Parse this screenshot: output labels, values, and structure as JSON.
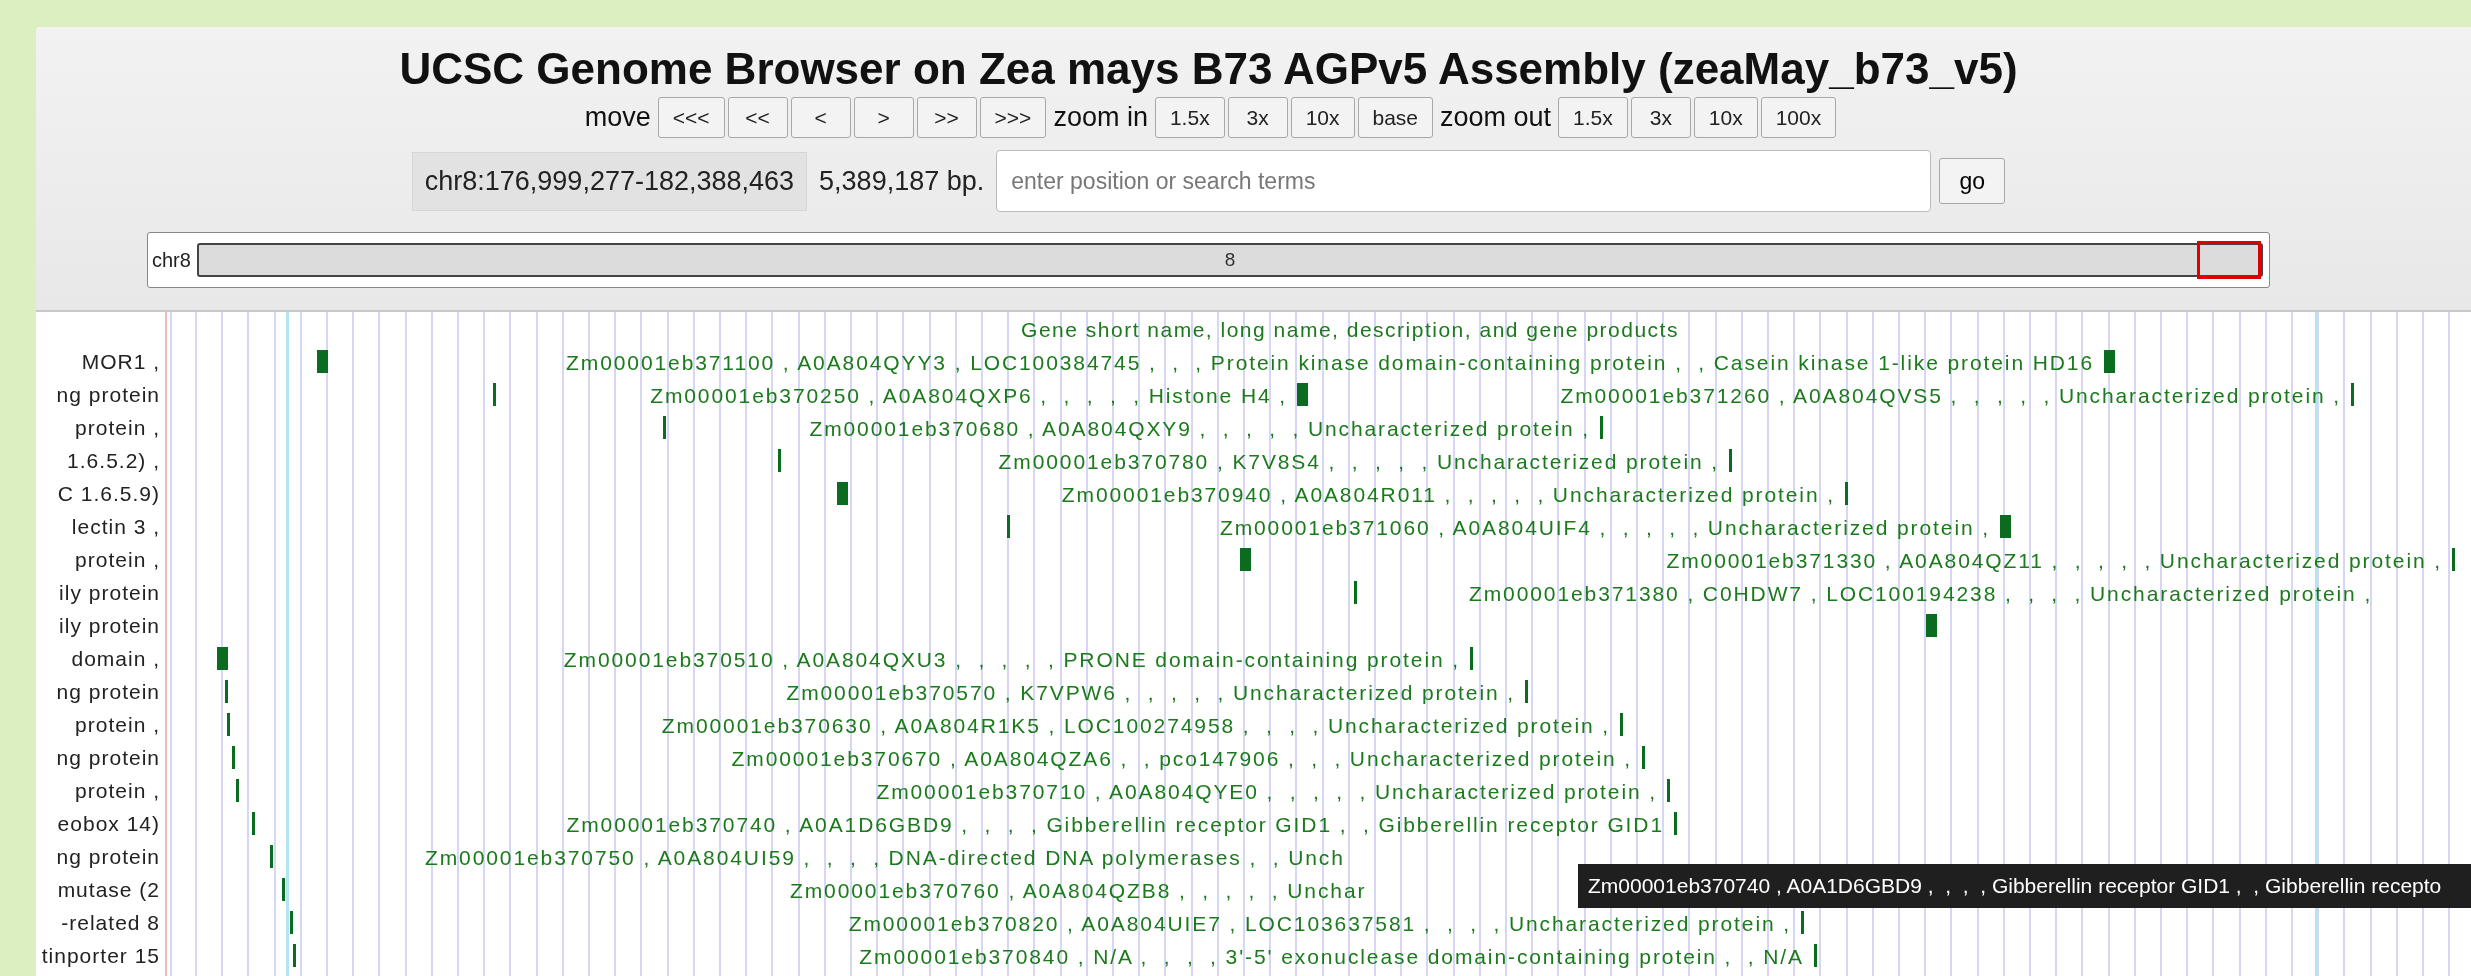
{
  "title": "UCSC Genome Browser on Zea mays B73 AGPv5 Assembly (zeaMay_b73_v5)",
  "navigation": [
    {
      "kind": "label",
      "text": "move"
    },
    {
      "kind": "button",
      "text": "<<<"
    },
    {
      "kind": "button",
      "text": "<<"
    },
    {
      "kind": "button",
      "text": "<"
    },
    {
      "kind": "button",
      "text": ">"
    },
    {
      "kind": "button",
      "text": ">>"
    },
    {
      "kind": "button",
      "text": ">>>"
    },
    {
      "kind": "label",
      "text": "zoom in"
    },
    {
      "kind": "button",
      "text": "1.5x"
    },
    {
      "kind": "button",
      "text": "3x"
    },
    {
      "kind": "button",
      "text": "10x"
    },
    {
      "kind": "button",
      "text": "base"
    },
    {
      "kind": "label",
      "text": "zoom out"
    },
    {
      "kind": "button",
      "text": "1.5x"
    },
    {
      "kind": "button",
      "text": "3x"
    },
    {
      "kind": "button",
      "text": "10x"
    },
    {
      "kind": "button",
      "text": "100x"
    }
  ],
  "position": {
    "range": "chr8:176,999,277-182,388,463",
    "size": "5,389,187 bp.",
    "search": {
      "placeholder": "enter position or search terms"
    },
    "go_button": "go"
  },
  "ideogram": {
    "chromosome": "chr8",
    "band_label": "8"
  },
  "track": {
    "title": "Gene short name, long name, description, and gene products",
    "rows": [
      {
        "left_label": "MOR1 ,",
        "genes": [
          "Zm00001eb371100 , A0A804QYY3 , LOC100384745 ,  ,  , Protein kinase domain-containing protein ,  , Casein kinase 1-like protein HD16"
        ]
      },
      {
        "left_label": "ng protein",
        "genes": [
          "Zm00001eb370250 , A0A804QXP6 ,  ,  ,  ,  , Histone H4 ,",
          "Zm00001eb371260 , A0A804QVS5 ,  ,  ,  ,  , Uncharacterized protein ,"
        ]
      },
      {
        "left_label": "protein ,",
        "genes": [
          "Zm00001eb370680 , A0A804QXY9 ,  ,  ,  ,  , Uncharacterized protein ,"
        ]
      },
      {
        "left_label": "1.6.5.2) ,",
        "genes": [
          "Zm00001eb370780 , K7V8S4 ,  ,  ,  ,  , Uncharacterized protein ,"
        ]
      },
      {
        "left_label": "C 1.6.5.9)",
        "genes": [
          "Zm00001eb370940 , A0A804R011 ,  ,  ,  ,  , Uncharacterized protein ,"
        ]
      },
      {
        "left_label": "lectin 3 ,",
        "genes": [
          "Zm00001eb371060 , A0A804UIF4 ,  ,  ,  ,  , Uncharacterized protein ,"
        ]
      },
      {
        "left_label": "protein ,",
        "genes": [
          "Zm00001eb371330 , A0A804QZ11 ,  ,  ,  ,  , Uncharacterized protein ,"
        ]
      },
      {
        "left_label": "ily protein",
        "genes": [
          "Zm00001eb371380 , C0HDW7 , LOC100194238 ,  ,  ,  , Uncharacterized protein ,"
        ]
      },
      {
        "left_label": "ily protein",
        "genes": []
      },
      {
        "left_label": "domain ,",
        "genes": [
          "Zm00001eb370510 , A0A804QXU3 ,  ,  ,  ,  , PRONE domain-containing protein ,"
        ]
      },
      {
        "left_label": "ng protein",
        "genes": [
          "Zm00001eb370570 , K7VPW6 ,  ,  ,  ,  , Uncharacterized protein ,"
        ]
      },
      {
        "left_label": "protein ,",
        "genes": [
          "Zm00001eb370630 , A0A804R1K5 , LOC100274958 ,  ,  ,  , Uncharacterized protein ,"
        ]
      },
      {
        "left_label": "ng protein",
        "genes": [
          "Zm00001eb370670 , A0A804QZA6 ,  , pco147906 ,  ,  , Uncharacterized protein ,"
        ]
      },
      {
        "left_label": "protein ,",
        "genes": [
          "Zm00001eb370710 , A0A804QYE0 ,  ,  ,  ,  , Uncharacterized protein ,"
        ]
      },
      {
        "left_label": "eobox 14)",
        "genes": [
          "Zm00001eb370740 , A0A1D6GBD9 ,  ,  ,  , Gibberellin receptor GID1 ,  , Gibberellin receptor GID1"
        ]
      },
      {
        "left_label": "ng protein",
        "genes": [
          "Zm00001eb370750 , A0A804UI59 ,  ,  ,  , DNA-directed DNA polymerases ,  , Unch"
        ]
      },
      {
        "left_label": "mutase (2",
        "genes": [
          "Zm00001eb370760 , A0A804QZB8 ,  ,  ,  ,  , Unchar"
        ]
      },
      {
        "left_label": "-related 8",
        "genes": [
          "Zm00001eb370820 , A0A804UIE7 , LOC103637581 ,  ,  ,  , Uncharacterized protein ,"
        ]
      },
      {
        "left_label": "tinporter 15",
        "genes": [
          "Zm00001eb370840 , N/A ,  ,  ,  , 3'-5' exonuclease domain-containing protein ,  , N/A"
        ]
      }
    ]
  },
  "tooltip": "Zm00001eb370740 , A0A1D6GBD9 ,  ,  ,  , Gibberellin receptor GID1 ,  , Gibberellin recepto"
}
